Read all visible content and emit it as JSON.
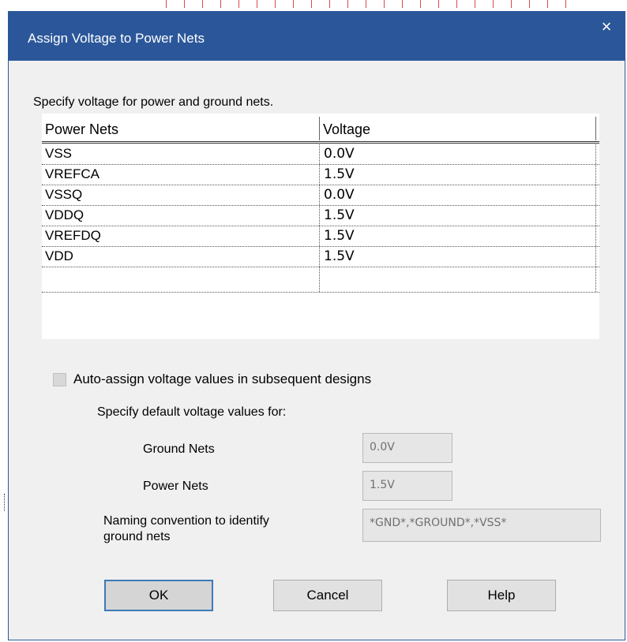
{
  "dialog": {
    "title": "Assign Voltage to Power Nets",
    "close_glyph": "×"
  },
  "instruction": "Specify voltage for power and ground nets.",
  "table": {
    "headers": [
      "Power Nets",
      "Voltage"
    ],
    "rows": [
      {
        "net": "VSS",
        "voltage": "0.0V"
      },
      {
        "net": "VREFCA",
        "voltage": "1.5V"
      },
      {
        "net": "VSSQ",
        "voltage": "0.0V"
      },
      {
        "net": "VDDQ",
        "voltage": "1.5V"
      },
      {
        "net": "VREFDQ",
        "voltage": "1.5V"
      },
      {
        "net": "VDD",
        "voltage": "1.5V"
      },
      {
        "net": "",
        "voltage": ""
      }
    ]
  },
  "auto_assign": {
    "label": "Auto-assign voltage values in subsequent designs",
    "checked": false
  },
  "defaults": {
    "heading": "Specify default voltage values for:",
    "ground_label": "Ground Nets",
    "ground_value": "0.0V",
    "power_label": "Power Nets",
    "power_value": "1.5V",
    "naming_label_line1": "Naming convention to identify",
    "naming_label_line2": "ground nets",
    "naming_value": "*GND*,*GROUND*,*VSS*"
  },
  "buttons": {
    "ok": "OK",
    "cancel": "Cancel",
    "help": "Help"
  },
  "colors": {
    "titlebar": "#2b579a",
    "dialog_bg": "#f0f0f0"
  }
}
